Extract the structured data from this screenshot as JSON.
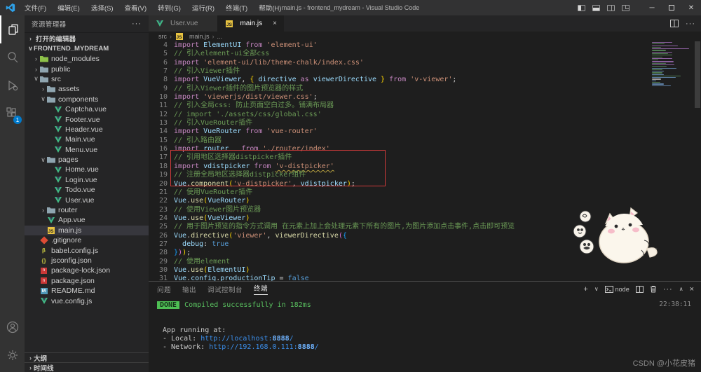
{
  "title_bar": {
    "menus": [
      "文件(F)",
      "编辑(E)",
      "选择(S)",
      "查看(V)",
      "转到(G)",
      "运行(R)",
      "终端(T)",
      "帮助(H)"
    ],
    "title": "main.js - frontend_mydream - Visual Studio Code"
  },
  "activity_bar": {
    "extensions_badge": "1"
  },
  "sidebar": {
    "header": "资源管理器",
    "open_editors": "打开的编辑器",
    "root": "FRONTEND_MYDREAM",
    "outline": "大纲",
    "timeline": "时间线",
    "tree": [
      {
        "label": "node_modules",
        "icon": "folder-green",
        "indent": 1,
        "chevron": "›"
      },
      {
        "label": "public",
        "icon": "folder",
        "indent": 1,
        "chevron": "›"
      },
      {
        "label": "src",
        "icon": "folder",
        "indent": 1,
        "chevron": "∨"
      },
      {
        "label": "assets",
        "icon": "folder",
        "indent": 2,
        "chevron": "›"
      },
      {
        "label": "components",
        "icon": "folder",
        "indent": 2,
        "chevron": "∨"
      },
      {
        "label": "Captcha.vue",
        "icon": "vue",
        "indent": 3
      },
      {
        "label": "Footer.vue",
        "icon": "vue",
        "indent": 3
      },
      {
        "label": "Header.vue",
        "icon": "vue",
        "indent": 3
      },
      {
        "label": "Main.vue",
        "icon": "vue",
        "indent": 3
      },
      {
        "label": "Menu.vue",
        "icon": "vue",
        "indent": 3
      },
      {
        "label": "pages",
        "icon": "folder",
        "indent": 2,
        "chevron": "∨"
      },
      {
        "label": "Home.vue",
        "icon": "vue",
        "indent": 3
      },
      {
        "label": "Login.vue",
        "icon": "vue",
        "indent": 3
      },
      {
        "label": "Todo.vue",
        "icon": "vue",
        "indent": 3
      },
      {
        "label": "User.vue",
        "icon": "vue",
        "indent": 3
      },
      {
        "label": "router",
        "icon": "folder",
        "indent": 2,
        "chevron": "›"
      },
      {
        "label": "App.vue",
        "icon": "vue",
        "indent": 2
      },
      {
        "label": "main.js",
        "icon": "js",
        "indent": 2,
        "selected": true
      },
      {
        "label": ".gitignore",
        "icon": "git",
        "indent": 1
      },
      {
        "label": "babel.config.js",
        "icon": "babel",
        "indent": 1
      },
      {
        "label": "jsconfig.json",
        "icon": "jsonc",
        "indent": 1
      },
      {
        "label": "package-lock.json",
        "icon": "npm",
        "indent": 1
      },
      {
        "label": "package.json",
        "icon": "npm",
        "indent": 1
      },
      {
        "label": "README.md",
        "icon": "md",
        "indent": 1
      },
      {
        "label": "vue.config.js",
        "icon": "vue",
        "indent": 1
      }
    ]
  },
  "editor": {
    "tabs": [
      {
        "label": "User.vue",
        "icon": "vue",
        "active": false
      },
      {
        "label": "main.js",
        "icon": "js",
        "active": true,
        "close": "×"
      }
    ],
    "breadcrumb": [
      "src",
      "main.js",
      "..."
    ],
    "lines": [
      {
        "n": 4,
        "tokens": [
          [
            "kw",
            "import "
          ],
          [
            "id",
            "ElementUI "
          ],
          [
            "kw",
            "from "
          ],
          [
            "str",
            "'element-ui'"
          ]
        ]
      },
      {
        "n": 5,
        "tokens": [
          [
            "cm",
            "// 引入element-ui全部css"
          ]
        ]
      },
      {
        "n": 6,
        "tokens": [
          [
            "kw",
            "import "
          ],
          [
            "str",
            "'element-ui/lib/theme-chalk/index.css'"
          ]
        ]
      },
      {
        "n": 7,
        "tokens": [
          [
            "cm",
            "// 引入Viewer插件"
          ]
        ]
      },
      {
        "n": 8,
        "tokens": [
          [
            "kw",
            "import "
          ],
          [
            "id",
            "VueViewer"
          ],
          [
            "pl",
            ", "
          ],
          [
            "b1",
            "{ "
          ],
          [
            "id",
            "directive "
          ],
          [
            "kw",
            "as "
          ],
          [
            "id",
            "viewerDirective "
          ],
          [
            "b1",
            "} "
          ],
          [
            "kw",
            "from "
          ],
          [
            "str",
            "'v-viewer'"
          ],
          [
            "pl",
            ";"
          ]
        ]
      },
      {
        "n": 9,
        "tokens": [
          [
            "cm",
            "// 引入Viewer插件的图片预览器的样式"
          ]
        ]
      },
      {
        "n": 10,
        "tokens": [
          [
            "kw",
            "import "
          ],
          [
            "str",
            "'viewerjs/dist/viewer.css'"
          ],
          [
            "pl",
            ";"
          ]
        ]
      },
      {
        "n": 11,
        "tokens": [
          [
            "cm",
            "// 引入全局css: 防止页面空白过多。铺满布局器"
          ]
        ]
      },
      {
        "n": 12,
        "tokens": [
          [
            "cm",
            "// import './assets/css/global.css'"
          ]
        ]
      },
      {
        "n": 13,
        "tokens": [
          [
            "cm",
            "// 引入VueRouter插件"
          ]
        ]
      },
      {
        "n": 14,
        "tokens": [
          [
            "kw",
            "import "
          ],
          [
            "id",
            "VueRouter "
          ],
          [
            "kw",
            "from "
          ],
          [
            "str",
            "'vue-router'"
          ]
        ]
      },
      {
        "n": 15,
        "tokens": [
          [
            "cm",
            "// 引入路由器"
          ]
        ]
      },
      {
        "n": 16,
        "tokens": [
          [
            "kw",
            "import "
          ],
          [
            "id",
            "router   "
          ],
          [
            "kw",
            "from "
          ],
          [
            "str",
            "'./router/index'"
          ]
        ]
      },
      {
        "n": 17,
        "tokens": [
          [
            "cm",
            "// 引用地区选择器distpicker插件"
          ]
        ]
      },
      {
        "n": 18,
        "tokens": [
          [
            "kw",
            "import "
          ],
          [
            "id",
            "vdistpicker "
          ],
          [
            "kw",
            "from "
          ],
          [
            "stru",
            "'v-distpicker'"
          ]
        ]
      },
      {
        "n": 19,
        "tokens": [
          [
            "cm",
            "// 注册全局地区选择器distpicker组件"
          ]
        ]
      },
      {
        "n": 20,
        "tokens": [
          [
            "id",
            "Vue"
          ],
          [
            "pl",
            "."
          ],
          [
            "fn",
            "component"
          ],
          [
            "b1",
            "("
          ],
          [
            "str",
            "'v-distpicker'"
          ],
          [
            "pl",
            ", "
          ],
          [
            "id",
            "vdistpicker"
          ],
          [
            "b1",
            ")"
          ],
          [
            "pl",
            ";"
          ]
        ]
      },
      {
        "n": 21,
        "tokens": [
          [
            "cm",
            "// 使用VueRouter插件"
          ]
        ]
      },
      {
        "n": 22,
        "tokens": [
          [
            "id",
            "Vue"
          ],
          [
            "pl",
            "."
          ],
          [
            "fn",
            "use"
          ],
          [
            "b1",
            "("
          ],
          [
            "id",
            "VueRouter"
          ],
          [
            "b1",
            ")"
          ]
        ]
      },
      {
        "n": 23,
        "tokens": [
          [
            "cm",
            "// 使用Viewer图片预览器"
          ]
        ]
      },
      {
        "n": 24,
        "tokens": [
          [
            "id",
            "Vue"
          ],
          [
            "pl",
            "."
          ],
          [
            "fn",
            "use"
          ],
          [
            "b1",
            "("
          ],
          [
            "id",
            "VueViewer"
          ],
          [
            "b1",
            ")"
          ]
        ]
      },
      {
        "n": 25,
        "tokens": [
          [
            "cm",
            "// 用于图片预览的指令方式调用 在元素上加上会处理元素下所有的图片,为图片添加点击事件,点击即可预览"
          ]
        ]
      },
      {
        "n": 26,
        "tokens": [
          [
            "id",
            "Vue"
          ],
          [
            "pl",
            "."
          ],
          [
            "fn",
            "directive"
          ],
          [
            "b1",
            "("
          ],
          [
            "str",
            "'viewer'"
          ],
          [
            "pl",
            ", "
          ],
          [
            "fn",
            "viewerDirective"
          ],
          [
            "b2",
            "("
          ],
          [
            "b3",
            "{"
          ]
        ]
      },
      {
        "n": 27,
        "tokens": [
          [
            "pl",
            "  "
          ],
          [
            "id",
            "debug"
          ],
          [
            "pl",
            ": "
          ],
          [
            "kw2",
            "true"
          ]
        ]
      },
      {
        "n": 28,
        "tokens": [
          [
            "b3",
            "}"
          ],
          [
            "b2",
            ")"
          ],
          [
            "b1",
            ")"
          ],
          [
            "pl",
            ";"
          ]
        ]
      },
      {
        "n": 29,
        "tokens": [
          [
            "cm",
            "// 使用element"
          ]
        ]
      },
      {
        "n": 30,
        "tokens": [
          [
            "id",
            "Vue"
          ],
          [
            "pl",
            "."
          ],
          [
            "fn",
            "use"
          ],
          [
            "b1",
            "("
          ],
          [
            "id",
            "ElementUI"
          ],
          [
            "b1",
            ")"
          ]
        ]
      },
      {
        "n": 31,
        "tokens": [
          [
            "id",
            "Vue"
          ],
          [
            "pl",
            "."
          ],
          [
            "id",
            "config"
          ],
          [
            "pl",
            "."
          ],
          [
            "id",
            "productionTip "
          ],
          [
            "pl",
            "= "
          ],
          [
            "kw2",
            "false"
          ]
        ]
      }
    ]
  },
  "panel": {
    "tabs": [
      "问题",
      "输出",
      "调试控制台",
      "终端"
    ],
    "active_tab": "终端",
    "shell_label": "node",
    "clock": "22:38:11",
    "output": {
      "badge": "DONE",
      "message": "Compiled successfully in 182ms",
      "running": "App running at:",
      "local_label": "- Local:  ",
      "local_url_prefix": "http://localhost:",
      "local_port": "8888",
      "local_suffix": "/",
      "network_label": "- Network: ",
      "network_url_prefix": "http://192.168.0.111:",
      "network_port": "8888",
      "network_suffix": "/"
    }
  },
  "watermark": "CSDN @小花皮猪"
}
